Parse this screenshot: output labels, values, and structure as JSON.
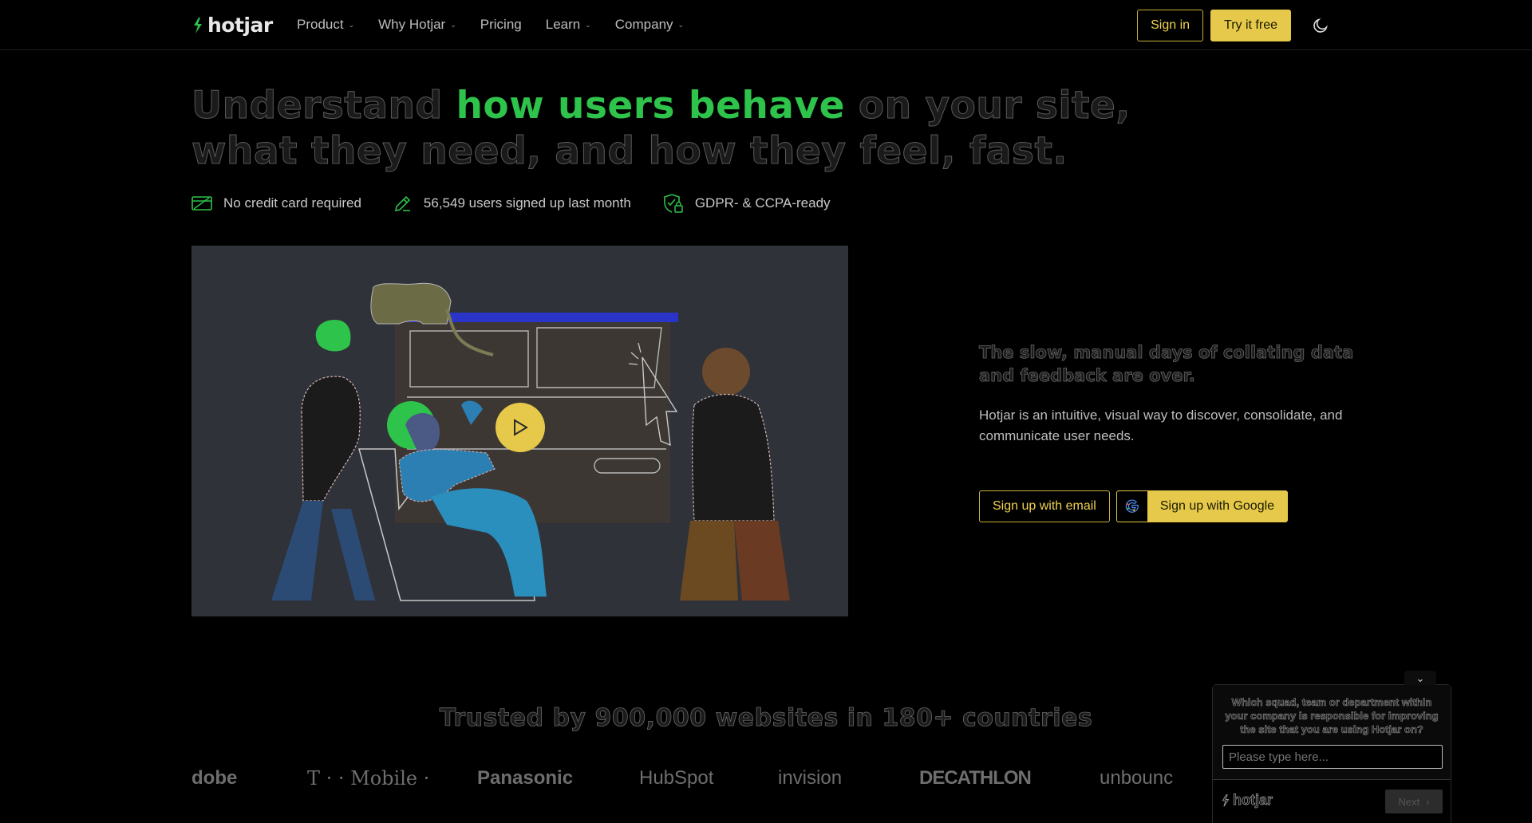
{
  "nav": {
    "brand": "hotjar",
    "links": [
      {
        "label": "Product",
        "has_caret": true
      },
      {
        "label": "Why Hotjar",
        "has_caret": true
      },
      {
        "label": "Pricing",
        "has_caret": false
      },
      {
        "label": "Learn",
        "has_caret": true
      },
      {
        "label": "Company",
        "has_caret": true
      }
    ],
    "sign_in": "Sign in",
    "try_free": "Try it free",
    "theme_icon": "moon-icon"
  },
  "hero": {
    "headline_pre": "Understand ",
    "headline_highlight": "how users behave",
    "headline_post": " on your site, what they need, and how they feel, fast.",
    "badges": [
      {
        "icon": "credit-card-icon",
        "text": "No credit card required"
      },
      {
        "icon": "pencil-icon",
        "text": "56,549 users signed up last month"
      },
      {
        "icon": "shield-lock-icon",
        "text": "GDPR- & CCPA-ready"
      }
    ]
  },
  "video": {
    "play_icon": "play-icon"
  },
  "copy": {
    "title": "The slow, manual days of collating data and feedback are over.",
    "body": "Hotjar is an intuitive, visual way to discover, consolidate, and communicate user needs.",
    "signup_email": "Sign up with email",
    "signup_google": "Sign up with Google"
  },
  "trusted": {
    "title": "Trusted by 900,000 websites in 180+ countries",
    "logos": [
      "dobe",
      "T · · Mobile ·",
      "Panasonic",
      "HubSpot",
      "invision",
      "DECATHLON",
      "unbounc"
    ]
  },
  "survey": {
    "close_icon": "chevron-down-icon",
    "question": "Which squad, team or department within your company is responsible for improving the site that you are using Hotjar on?",
    "placeholder": "Please type here...",
    "brand": "hotjar",
    "next": "Next"
  },
  "colors": {
    "accent_green": "#2ec34a",
    "accent_yellow": "#e6c94a",
    "background": "#000000"
  }
}
